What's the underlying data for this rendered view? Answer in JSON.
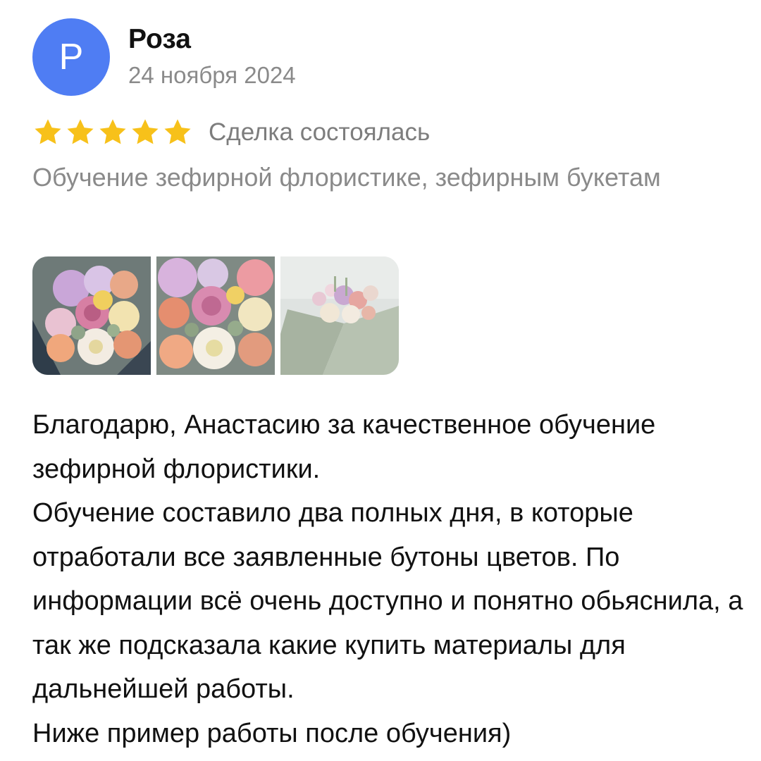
{
  "author": {
    "avatar_letter": "Р",
    "avatar_color": "#4f7df3",
    "name": "Роза",
    "date": "24 ноября 2024"
  },
  "rating": {
    "stars": 5,
    "max_stars": 5,
    "star_color": "#f7c11a",
    "deal_status": "Сделка состоялась"
  },
  "service": {
    "title": "Обучение зефирной флористике, зефирным букетам"
  },
  "photos": [
    {
      "icon": "flower-bouquet-photo"
    },
    {
      "icon": "flower-bouquet-closeup-photo"
    },
    {
      "icon": "wrapped-bouquet-photo"
    }
  ],
  "review": {
    "paragraphs": [
      "Благодарю, Анастасию за качественное обучение зефирной флористики.",
      "Обучение составило два полных дня, в которые отработали все заявленные бутоны цветов. По информации всё очень доступно и понятно обьяснила, а так же подсказала какие купить материалы для дальнейшей работы.",
      "Ниже пример работы после обучения)"
    ]
  }
}
